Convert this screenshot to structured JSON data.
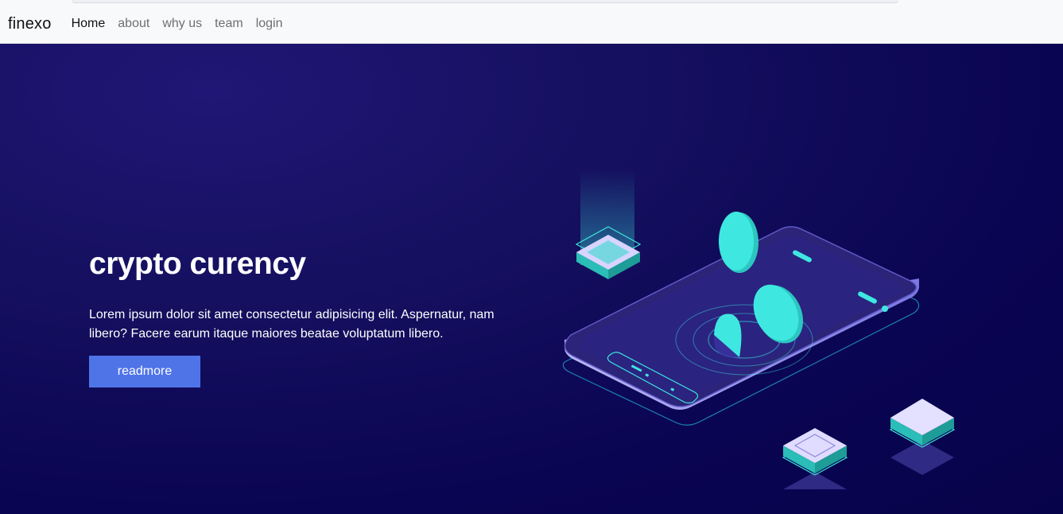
{
  "navbar": {
    "brand": "finexo",
    "links": [
      {
        "label": "Home",
        "active": true
      },
      {
        "label": "about",
        "active": false
      },
      {
        "label": "why us",
        "active": false
      },
      {
        "label": "team",
        "active": false
      },
      {
        "label": "login",
        "active": false
      }
    ]
  },
  "hero": {
    "title": "crypto curency",
    "text": "Lorem ipsum dolor sit amet consectetur adipisicing elit. Aspernatur, nam libero? Facere earum itaque maiores beatae voluptatum libero.",
    "button_label": "readmore",
    "illustration_icon": "crypto-phone-illustration"
  },
  "colors": {
    "navbar_bg": "#f8f9fa",
    "hero_bg": "#0b0550",
    "button_bg": "#4f74e8",
    "coin": "#3ee8e0"
  }
}
